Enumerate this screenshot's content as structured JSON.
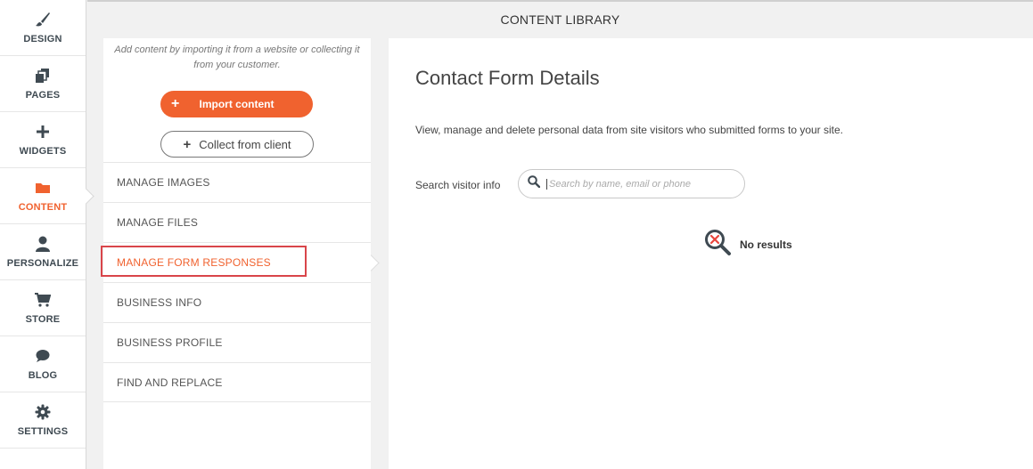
{
  "nav": {
    "items": [
      {
        "label": "DESIGN",
        "icon": "brush-icon"
      },
      {
        "label": "PAGES",
        "icon": "pages-icon"
      },
      {
        "label": "WIDGETS",
        "icon": "plus-icon"
      },
      {
        "label": "CONTENT",
        "icon": "folder-icon"
      },
      {
        "label": "PERSONALIZE",
        "icon": "person-icon"
      },
      {
        "label": "STORE",
        "icon": "cart-icon"
      },
      {
        "label": "BLOG",
        "icon": "chat-bubble-icon"
      },
      {
        "label": "SETTINGS",
        "icon": "gear-icon"
      }
    ],
    "active_index": 3
  },
  "header": {
    "title": "CONTENT LIBRARY"
  },
  "library": {
    "description": "Add content by importing it from a website or collecting it from your customer.",
    "import_label": "Import content",
    "collect_label": "Collect from client",
    "items": [
      {
        "label": "MANAGE IMAGES"
      },
      {
        "label": "MANAGE FILES"
      },
      {
        "label": "MANAGE FORM RESPONSES"
      },
      {
        "label": "BUSINESS INFO"
      },
      {
        "label": "BUSINESS PROFILE"
      },
      {
        "label": "FIND AND REPLACE"
      }
    ],
    "active_index": 2
  },
  "main": {
    "title": "Contact Form Details",
    "description": "View, manage and delete personal data from site visitors who submitted forms to your site.",
    "search_label": "Search visitor info",
    "search_placeholder": "Search by name, email or phone",
    "search_value": "",
    "no_results": "No results"
  },
  "colors": {
    "accent": "#f0622f",
    "highlight_border": "#d9454a",
    "nav_icon": "#3f4a52"
  }
}
